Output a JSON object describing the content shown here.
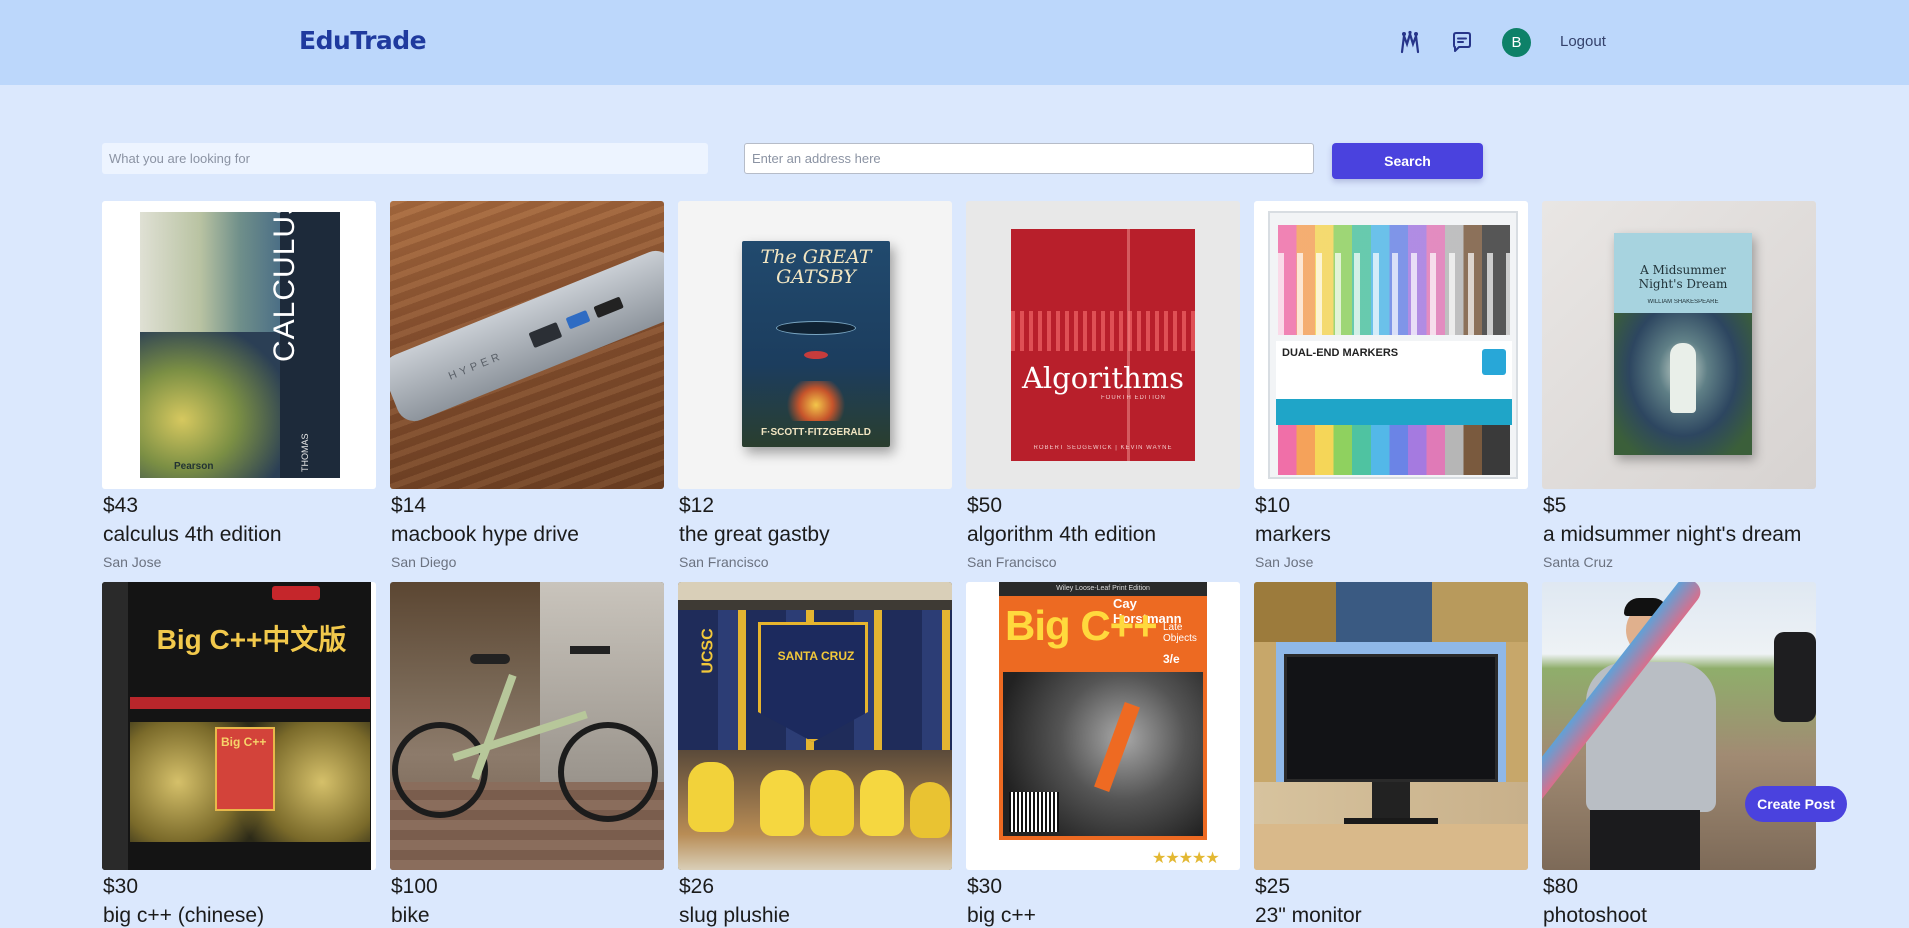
{
  "app": {
    "name": "EduTrade"
  },
  "header": {
    "avatar_initial": "B",
    "logout_label": "Logout"
  },
  "search": {
    "what_placeholder": "What you are looking for",
    "address_placeholder": "Enter an address here",
    "button_label": "Search"
  },
  "listings": [
    {
      "price": "$43",
      "title": "calculus 4th edition",
      "location": "San Jose",
      "cover_text": "CALCULUS",
      "cover_sub": "THOMAS",
      "publisher": "Pearson"
    },
    {
      "price": "$14",
      "title": "macbook hype drive",
      "location": "San Diego",
      "brand": "HYPER"
    },
    {
      "price": "$12",
      "title": "the great gastby",
      "location": "San Francisco",
      "cover_title": "The GREAT GATSBY",
      "cover_author": "F·SCOTT·FITZGERALD"
    },
    {
      "price": "$50",
      "title": "algorithm 4th edition",
      "location": "San Francisco",
      "cover_title": "Algorithms",
      "cover_edition": "FOURTH EDITION",
      "cover_authors": "ROBERT SEDGEWICK | KEVIN WAYNE"
    },
    {
      "price": "$10",
      "title": "markers",
      "location": "San Jose",
      "box_text": "DUAL-END MARKERS"
    },
    {
      "price": "$5",
      "title": "a midsummer night's dream",
      "location": "Santa Cruz",
      "cover_title": "A Midsummer Night's Dream",
      "cover_author": "WILLIAM SHAKESPEARE"
    },
    {
      "price": "$30",
      "title": "big c++ (chinese)",
      "location": "",
      "cover_title": "Big C++中文版",
      "cover_mini": "Big C++"
    },
    {
      "price": "$100",
      "title": "bike",
      "location": ""
    },
    {
      "price": "$26",
      "title": "slug plushie",
      "location": "",
      "pennant_text": "SANTA CRUZ",
      "pennant_side": "UCSC"
    },
    {
      "price": "$30",
      "title": "big c++",
      "location": "",
      "cover_title": "Big C++",
      "cover_author": "Cay Horstmann",
      "cover_top": "Wiley Loose-Leaf Print Edition",
      "cover_sub": "Late Objects",
      "cover_edition": "3/e",
      "rating_stars": "★★★★★"
    },
    {
      "price": "$25",
      "title": "23\" monitor",
      "location": ""
    },
    {
      "price": "$80",
      "title": "photoshoot",
      "location": ""
    }
  ],
  "fab": {
    "create_label": "Create Post"
  },
  "colors": {
    "header_bg": "#bcd7fb",
    "page_bg": "#dbe8fd",
    "accent": "#4a42de",
    "logo": "#1f3a9e",
    "avatar": "#0d8168"
  },
  "icons": {
    "header_left": "connections-icon",
    "header_right": "chat-icon"
  }
}
